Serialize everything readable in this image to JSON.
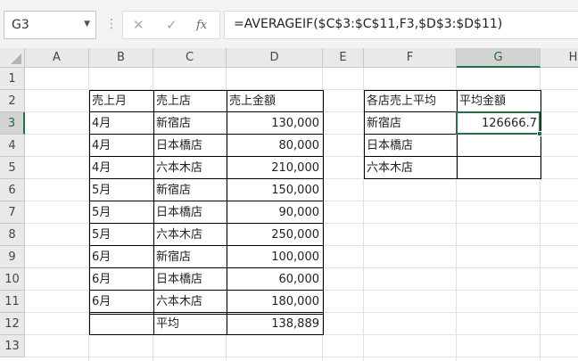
{
  "formula_bar": {
    "name_box": "G3",
    "cancel_icon": "✕",
    "enter_icon": "✓",
    "fx_icon": "fx",
    "formula": "=AVERAGEIF($C$3:$C$11,F3,$D$3:$D$11)"
  },
  "columns": [
    "A",
    "B",
    "C",
    "D",
    "E",
    "F",
    "G",
    "H"
  ],
  "rows": [
    "1",
    "2",
    "3",
    "4",
    "5",
    "6",
    "7",
    "8",
    "9",
    "10",
    "11",
    "12",
    "13"
  ],
  "sales_table": {
    "headers": [
      "売上月",
      "売上店",
      "売上金額"
    ],
    "rows": [
      [
        "4月",
        "新宿店",
        "130,000"
      ],
      [
        "4月",
        "日本橋店",
        "80,000"
      ],
      [
        "4月",
        "六本木店",
        "210,000"
      ],
      [
        "5月",
        "新宿店",
        "150,000"
      ],
      [
        "5月",
        "日本橋店",
        "90,000"
      ],
      [
        "5月",
        "六本木店",
        "250,000"
      ],
      [
        "6月",
        "新宿店",
        "100,000"
      ],
      [
        "6月",
        "日本橋店",
        "60,000"
      ],
      [
        "6月",
        "六本木店",
        "180,000"
      ]
    ],
    "average_label": "平均",
    "average_value": "138,889"
  },
  "summary_table": {
    "headers": [
      "各店売上平均",
      "平均金額"
    ],
    "rows": [
      [
        "新宿店",
        "126666.7"
      ],
      [
        "日本橋店",
        ""
      ],
      [
        "六本木店",
        ""
      ]
    ]
  },
  "selected_cell": "G3",
  "accent_color": "#217346"
}
